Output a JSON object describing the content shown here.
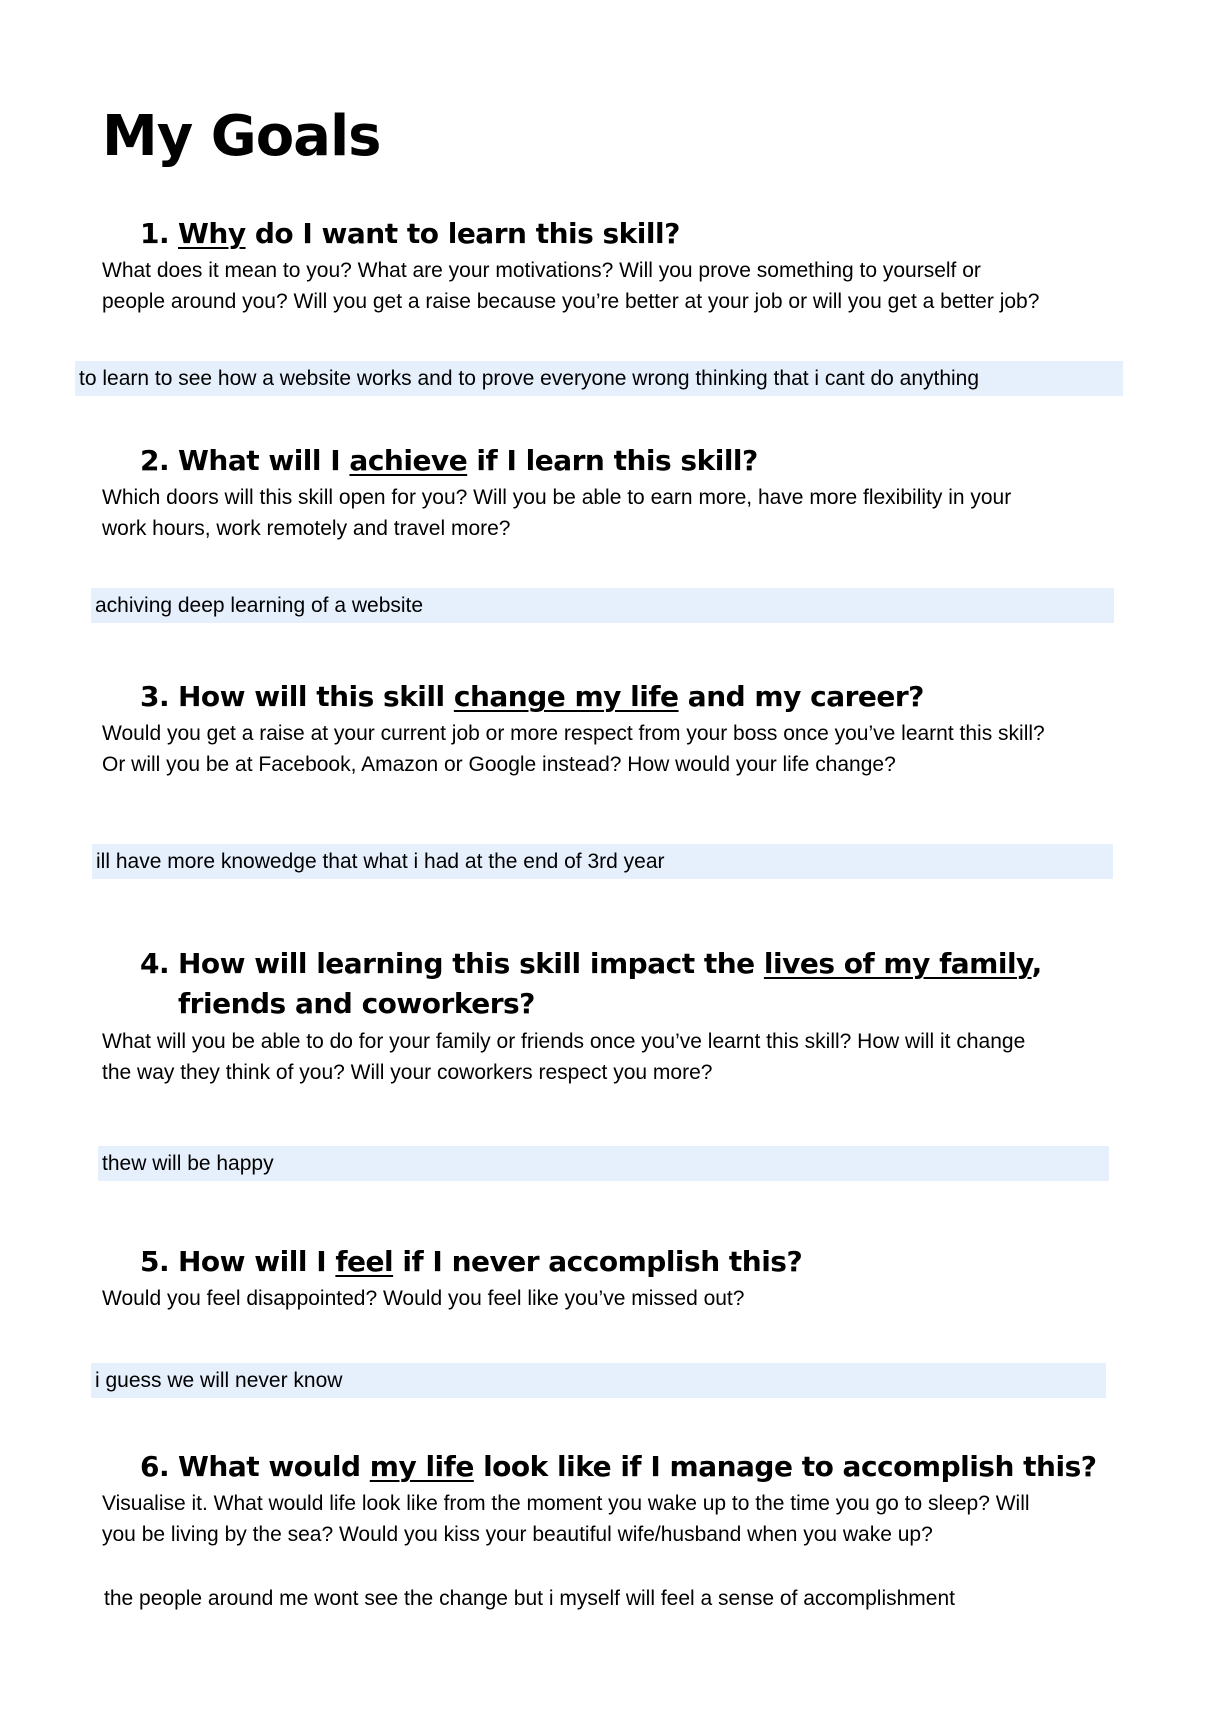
{
  "title": "My Goals",
  "questions": [
    {
      "num": "1.",
      "pre": "",
      "u": "Why",
      "post": " do I want to learn this skill?",
      "line2": "",
      "body": [
        "What does it mean to you? What are your motivations? Will you prove something to yourself or",
        "people around you? Will you get a raise because you’re better at your job or will you get a better job?"
      ],
      "answer": "to learn to see how a website works and to prove everyone wrong thinking that i cant do anything"
    },
    {
      "num": "2.",
      "pre": "What will I ",
      "u": "achieve",
      "post": " if I learn this skill?",
      "line2": "",
      "body": [
        "Which doors will this skill open for you? Will you be able to earn more, have more flexibility in your",
        "work hours, work remotely and travel more?"
      ],
      "answer": "achiving deep learning of a website"
    },
    {
      "num": "3.",
      "pre": "How will this skill ",
      "u": "change my life",
      "post": " and my career?",
      "line2": "",
      "body": [
        "Would you get a raise at your current job or more respect from your boss once you’ve learnt this skill?",
        "Or will you be at Facebook, Amazon or Google instead? How would your life change?"
      ],
      "answer": "ill have more knowedge that what i had at the end of 3rd year"
    },
    {
      "num": "4.",
      "pre": "How will learning this skill impact the ",
      "u": "lives of my family",
      "post": ",",
      "line2": "friends and coworkers?",
      "body": [
        "What will you be able to do for your family or friends once you’ve learnt this skill? How will it change",
        "the way they think of you? Will your coworkers respect you more?"
      ],
      "answer": "thew will be happy"
    },
    {
      "num": "5.",
      "pre": "How will I ",
      "u": "feel",
      "post": " if I never accomplish this?",
      "line2": "",
      "body": [
        "Would you feel disappointed? Would you feel like you’ve missed out?"
      ],
      "answer": "i guess we will never know"
    },
    {
      "num": "6.",
      "pre": "What would ",
      "u": "my life",
      "post": " look like if I manage to accomplish this?",
      "line2": "",
      "body": [
        "Visualise it. What would life look like from the moment you wake up to the time you go to sleep? Will",
        "you be living by the sea? Would you kiss your beautiful wife/husband when you wake up?"
      ],
      "answer": "the people around me wont see the change but i myself will feel a sense of accomplishment"
    }
  ],
  "colors": {
    "answer_highlight": "#e6effc",
    "text": "#000000"
  }
}
